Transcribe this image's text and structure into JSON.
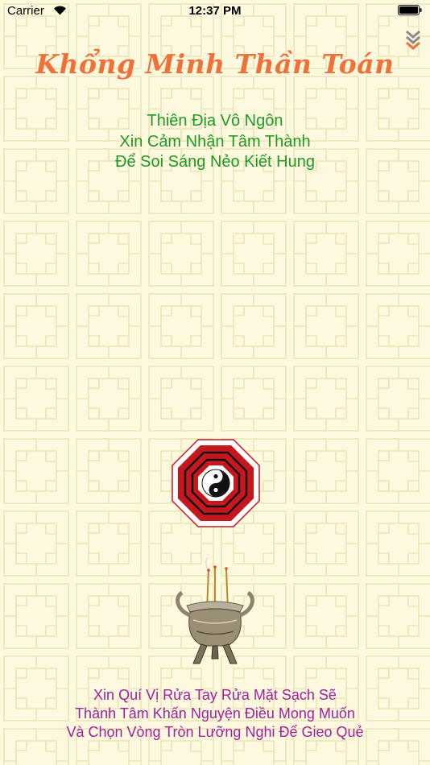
{
  "status_bar": {
    "carrier": "Carrier",
    "time": "12:37 PM"
  },
  "header": {
    "title": "Khổng Minh Thần Toán",
    "menu_icon": "double-chevron-down-icon"
  },
  "intro_lines": [
    "Thiên Địa Vô Ngôn",
    "Xin Cảm Nhận Tâm Thành",
    "Để Soi Sáng Nẻo Kiết Hung"
  ],
  "instruction_lines": [
    "Xin Quí Vị Rửa Tay Rửa Mặt Sạch Sẽ",
    "Thành Tâm Khấn Nguyện Điều Mong Muốn",
    "Và Chọn Vòng Tròn Lưỡng Nghi Để Gieo Quẻ"
  ],
  "colors": {
    "title": "#f0703a",
    "intro": "#1d9a22",
    "instruction": "#a021a0",
    "background": "#fdf9df",
    "bagua": "#c8161d"
  }
}
